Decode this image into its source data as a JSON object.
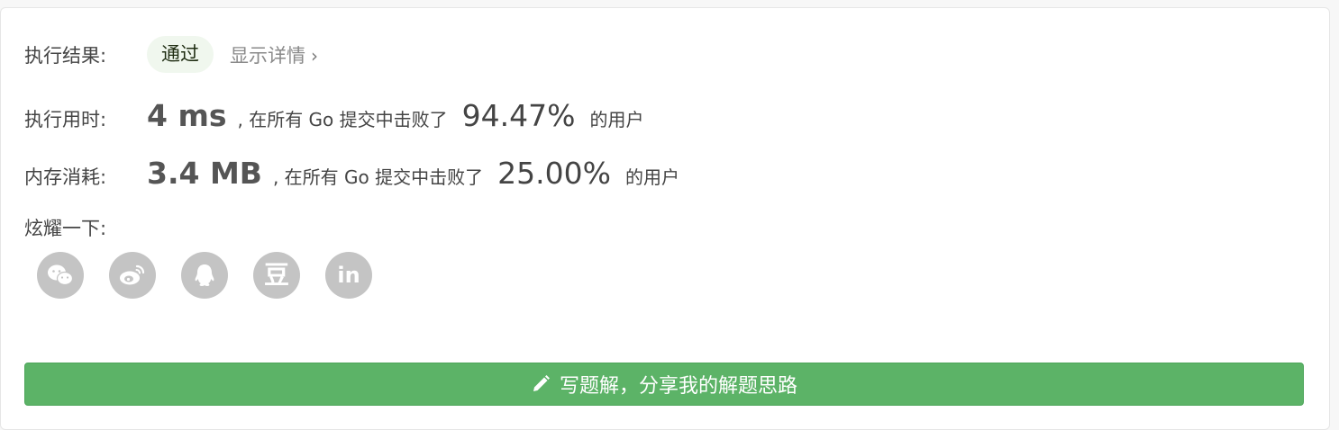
{
  "result": {
    "label": "执行结果:",
    "status": "通过",
    "details_link": "显示详情",
    "chevron": "›"
  },
  "runtime": {
    "label": "执行用时:",
    "value": "4 ms",
    "middle": ", 在所有 Go 提交中击败了",
    "percent": "94.47%",
    "suffix": "的用户"
  },
  "memory": {
    "label": "内存消耗:",
    "value": "3.4 MB",
    "middle": ", 在所有 Go 提交中击败了",
    "percent": "25.00%",
    "suffix": "的用户"
  },
  "share": {
    "label": "炫耀一下:",
    "buttons": [
      {
        "icon": "wechat-icon"
      },
      {
        "icon": "weibo-icon"
      },
      {
        "icon": "qq-icon"
      },
      {
        "icon": "douban-icon",
        "glyph": "豆"
      },
      {
        "icon": "linkedin-icon",
        "glyph": "in"
      }
    ]
  },
  "write_solution": {
    "label": "写题解，分享我的解题思路"
  },
  "colors": {
    "accent_green": "#5cb367",
    "pill_bg": "#f0f7ee",
    "share_icon_bg": "#c4c4c4"
  }
}
